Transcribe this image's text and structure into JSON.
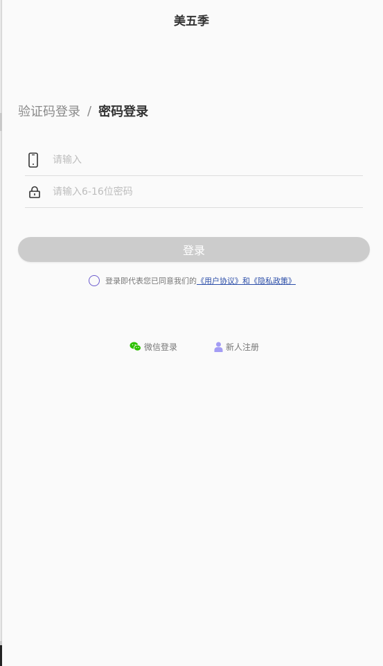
{
  "header": {
    "title": "美五季"
  },
  "login_modes": {
    "sms": "验证码登录",
    "separator": "/",
    "password": "密码登录"
  },
  "form": {
    "phone_placeholder": "请输入",
    "password_placeholder": "请输入6-16位密码"
  },
  "login_button": "登录",
  "agreement": {
    "prefix": "登录即代表您已同意我们的",
    "user_agreement": "《用户协议》",
    "and": "和",
    "privacy_policy": "《隐私政策》"
  },
  "alternatives": {
    "wechat": "微信登录",
    "register": "新人注册"
  },
  "colors": {
    "wechat": "#2dc100",
    "register": "#a39cf4",
    "radio": "#6a5acd",
    "link": "#2b4da8",
    "button": "#cccccc"
  }
}
